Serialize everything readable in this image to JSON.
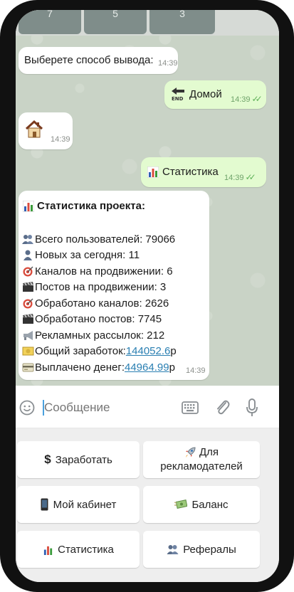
{
  "top_keys": [
    "7",
    "5",
    "3"
  ],
  "messages": {
    "choose": {
      "text": "Выберете способ вывода:",
      "time": "14:39"
    },
    "home_cmd": {
      "text": "Домой",
      "time": "14:39"
    },
    "house": {
      "emoji": "🏠",
      "time": "14:39"
    },
    "stats_cmd": {
      "text": "Статистика",
      "time": "14:39"
    },
    "stats": {
      "title": "Статистика проекта:",
      "lines": {
        "users": "Всего пользователей: 79066",
        "new_today": "Новых за сегодня: 11",
        "channels_promo": "Каналов на продвижении: 6",
        "posts_promo": "Постов на продвижении: 3",
        "channels_done": "Обработано каналов: 2626",
        "posts_done": "Обработано постов: 7745",
        "mailings": "Рекламных рассылок: 212",
        "earned_label": "Общий заработок: ",
        "earned_value": "144052.6",
        "earned_unit": "р",
        "paid_label": "Выплачено денег: ",
        "paid_value": "44964.99",
        "paid_unit": "р"
      },
      "time": "14:39"
    }
  },
  "input": {
    "placeholder": "Сообщение"
  },
  "keyboard": {
    "earn": "Заработать",
    "advertisers_1": "Для",
    "advertisers_2": "рекламодателей",
    "cabinet": "Мой кабинет",
    "balance": "Баланс",
    "stats": "Статистика",
    "referrals": "Рефералы"
  },
  "colors": {
    "out_bubble": "#e3fbd0",
    "link": "#2a7fb2",
    "chat_bg": "#c9d3c6"
  }
}
